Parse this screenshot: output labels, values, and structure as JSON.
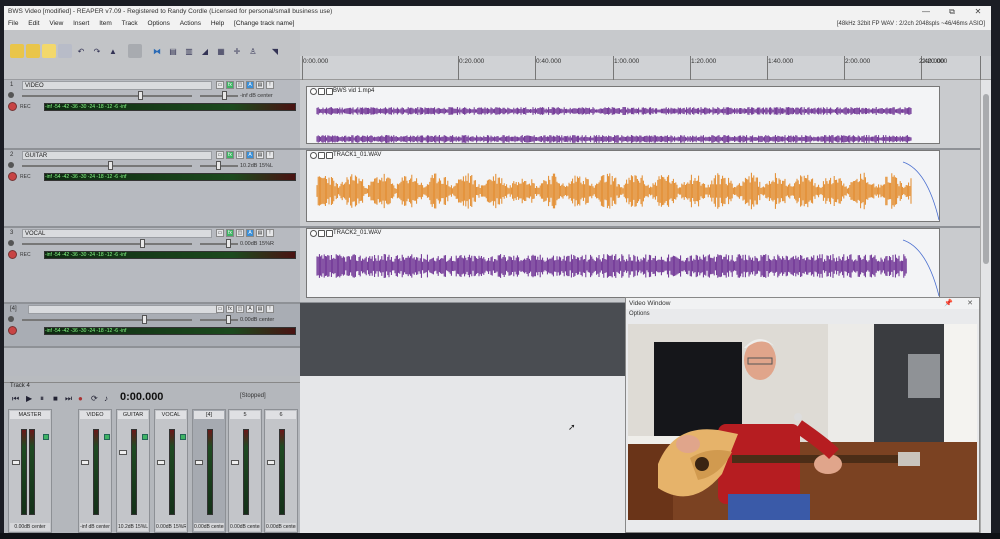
{
  "window": {
    "title": "BWS Video [modified] - REAPER v7.09 - Registered to Randy Cordle (Licensed for personal/small business use)",
    "status": "[48kHz 32bit FP WAV : 2/2ch 2048spls ~46/46ms ASIO]",
    "minimize": "—",
    "maximize": "⧉",
    "close": "✕"
  },
  "menu": [
    "File",
    "Edit",
    "View",
    "Insert",
    "Item",
    "Track",
    "Options",
    "Actions",
    "Help",
    "[Change track name]"
  ],
  "ruler": {
    "labels": [
      "0:00.000",
      "0:20.000",
      "0:40.000",
      "1:00.000",
      "1:20.000",
      "1:40.000",
      "2:00.000",
      "2:20.000",
      "2:40.000"
    ]
  },
  "tracks": [
    {
      "num": "1",
      "name": "VIDEO",
      "volume": "-inf dB center",
      "meter_scale": "-inf -54 -42 -36 -30 -24 -18 -12 -6 -inf",
      "item": "BWS vid 1.mp4",
      "wave_color": "#6a2c91"
    },
    {
      "num": "2",
      "name": "GUITAR",
      "volume": "10.2dB 15%L",
      "meter_scale": "-inf -54 -42 -36 -30 -24 -18 -12 -6 -inf",
      "item": "TRACK1_01.WAV",
      "wave_color": "#e38a2a"
    },
    {
      "num": "3",
      "name": "VOCAL",
      "volume": "0.00dB 15%R",
      "meter_scale": "-inf -54 -42 -36 -30 -24 -18 -12 -6 -inf",
      "item": "TRACK2_01.WAV",
      "wave_color": "#6a2c91"
    },
    {
      "num": "4",
      "name": "",
      "volume": "0.00dB center",
      "meter_scale": "-inf -54 -42 -36 -30 -24 -18 -12 -6 -inf",
      "item": "",
      "wave_color": ""
    }
  ],
  "transport": {
    "track_label": "Track 4",
    "time": "0:00.000",
    "state": "[Stopped]"
  },
  "mixer": {
    "strips": [
      {
        "name": "MASTER",
        "volume": "0.00dB center"
      },
      {
        "name": "VIDEO",
        "volume": "-inf dB center"
      },
      {
        "name": "GUITAR",
        "volume": "10.2dB 15%L"
      },
      {
        "name": "VOCAL",
        "volume": "0.00dB 15%R"
      },
      {
        "name": "[4]",
        "volume": "0.00dB center"
      },
      {
        "name": "5",
        "volume": "0.00dB center"
      },
      {
        "name": "6",
        "volume": "0.00dB center"
      }
    ]
  },
  "video_window": {
    "title": "Video Window",
    "options": "Options"
  },
  "colors": {
    "accent_green": "#3fb364",
    "accent_blue": "#3a8fd8",
    "wave_purple": "#6a2c91",
    "wave_orange": "#e38a2a"
  }
}
